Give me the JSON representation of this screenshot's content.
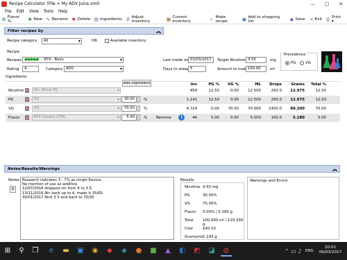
{
  "window": {
    "title": "Recipe Calculator (File = My ADV Juice.xml)",
    "minimize": "—",
    "maximize": "□",
    "close": "✕"
  },
  "menu": [
    "File",
    "Edit",
    "View",
    "Tools",
    "Help"
  ],
  "toolbar": [
    {
      "icon": "flavor-icon",
      "glyph": "❂",
      "color": "#2a8a3a",
      "label": "Flavor %"
    },
    {
      "icon": "new-icon",
      "glyph": "✚",
      "color": "#2a7a2a",
      "label": "New"
    },
    {
      "icon": "rename-icon",
      "glyph": "✎",
      "color": "#7a5a2a",
      "label": "Rename"
    },
    {
      "icon": "delete-icon",
      "glyph": "✖",
      "color": "#d02020",
      "label": "Delete"
    },
    {
      "icon": "ingredients-icon",
      "glyph": "▤",
      "color": "#3a6ab0",
      "label": "Ingredients"
    },
    {
      "icon": "adjust-icon",
      "glyph": "⇵",
      "color": "#3a6ab0",
      "label": "Adjust inventory"
    },
    {
      "icon": "inventory-icon",
      "glyph": "▦",
      "color": "#8a5a2a",
      "label": "Current inventory"
    },
    {
      "icon": "make-recipe-icon",
      "glyph": "✓",
      "color": "#2a8a2a",
      "label": "Make recipe"
    },
    {
      "icon": "shopping-list-icon",
      "glyph": "▣",
      "color": "#3a6ab0",
      "label": "Add to shopping list"
    },
    {
      "icon": "save-icon",
      "glyph": "▪",
      "color": "#2a4aa0",
      "label": "Save"
    },
    {
      "icon": "exit-icon",
      "glyph": "⇥",
      "color": "#2a8a3a",
      "label": "Exit"
    },
    {
      "icon": "print-icon",
      "glyph": "⎙",
      "color": "#555555",
      "label": "Print ▾"
    }
  ],
  "filter": {
    "header": "Filter recipes by",
    "category_label": "Recipe category",
    "category_value": "All",
    "or_label": "OR",
    "available_label": "Available inventory"
  },
  "recipe": {
    "section_label": "Recipe",
    "recipes_label": "Recipes",
    "recipe_value": "RY4 - Basic",
    "stars": "●●●●●",
    "rating_label": "Rating",
    "rating_value": "4",
    "category_label": "Category",
    "category_value": "ADV",
    "last_made_label": "Last made on",
    "last_made_value": "03/03/2017",
    "target_nicotine_label": "Target Nicotine",
    "target_nicotine_value": "4.50",
    "target_nicotine_unit": "mg",
    "days_steep_label": "Days to steep",
    "days_steep_value": "5",
    "amount_label": "Amount to make",
    "amount_value": "100.00",
    "amount_unit": "ml",
    "precedence_label": "Precedence",
    "pg_label": "PG",
    "vg_label": "VG"
  },
  "ingredients": {
    "section_label": "Ingredients",
    "add_button": "Add Ingredient",
    "headers": [
      "Inv",
      "PG %",
      "VG %",
      "ML",
      "Drops",
      "Grams",
      "Total %"
    ],
    "rows": [
      {
        "label": "Nicotine",
        "name": "Nic 36mg PG",
        "pct": "",
        "unit": "",
        "remove": "",
        "inv": "459",
        "pg": "12.50",
        "vg": "0.00",
        "ml": "12.500",
        "drops": "250.0",
        "grams": "12.975",
        "total": "12.50"
      },
      {
        "label": "PG",
        "name": "PG",
        "pct": "30.00",
        "unit": "%",
        "remove": "",
        "inv": "1,141",
        "pg": "12.50",
        "vg": "0.00",
        "ml": "12.500",
        "drops": "250.0",
        "grams": "12.975",
        "total": "12.50"
      },
      {
        "label": "VG",
        "name": "VG",
        "pct": "70.00",
        "unit": "%",
        "remove": "",
        "inv": "4,724",
        "pg": "0.00",
        "vg": "70.00",
        "ml": "70.000",
        "drops": "1400.0",
        "grams": "88.200",
        "total": "70.00"
      },
      {
        "label": "Flavor",
        "name": "RY4 Double (TFA)",
        "pct": "5.00",
        "unit": "%",
        "remove": "Remove",
        "inv": "46",
        "pg": "5.00",
        "vg": "0.00",
        "ml": "5.000",
        "drops": "100.0",
        "grams": "5.180",
        "total": "5.00"
      }
    ]
  },
  "notes": {
    "header": "Notes/Results/Warnings",
    "notes_label": "Notes",
    "d_button": "D",
    "lines": [
      "Research indicates 3 - 7% as single flavour.",
      "No mention of use as additive",
      "12/07/2016 dropped nic from 4 to 3.5.",
      "13/11/2016 Nic back up to 4, made it 35/65.",
      "30/01/2017 Nick 3.5 and back to 70/30"
    ],
    "results_label": "Results",
    "results": [
      {
        "label": "Nicotine",
        "value": "4.50 mg"
      },
      {
        "label": "PG",
        "value": "30.00%"
      },
      {
        "label": "VG",
        "value": "70.00%"
      },
      {
        "label": "Flavor",
        "value": "5.00% / 5.180 g"
      },
      {
        "label": "Total",
        "value": "100.000 ml / 119.330 g"
      },
      {
        "label": "Cost",
        "value": "£40.10"
      },
      {
        "label": "Grams/ml",
        "value": "1.193 g"
      }
    ],
    "warnings_label": "Warnings and Errors"
  },
  "taskbar": {
    "start": "⊞",
    "search": "⚲",
    "taskview": "❐",
    "apps": [
      {
        "name": "edge-icon",
        "glyph": "e",
        "color": "#3b8fe0"
      },
      {
        "name": "explorer-icon",
        "glyph": "▬",
        "color": "#e8c250"
      },
      {
        "name": "store-icon",
        "glyph": "▣",
        "color": "#3b8fe0"
      },
      {
        "name": "chrome-icon",
        "glyph": "◉",
        "color": "#e0b030"
      },
      {
        "name": "app-icon-1",
        "glyph": "◆",
        "color": "#d04040"
      },
      {
        "name": "app-icon-2",
        "glyph": "◈",
        "color": "#40a0d0"
      },
      {
        "name": "app-icon-3",
        "glyph": "●",
        "color": "#e07030"
      },
      {
        "name": "app-icon-4",
        "glyph": "■",
        "color": "#60b040"
      },
      {
        "name": "app-icon-5",
        "glyph": "▲",
        "color": "#9060d0"
      },
      {
        "name": "app-icon-6",
        "glyph": "◧",
        "color": "#3070c0"
      },
      {
        "name": "app-icon-7",
        "glyph": "◩",
        "color": "#d03030"
      },
      {
        "name": "app-icon-8",
        "glyph": "◪",
        "color": "#30a0a0"
      },
      {
        "name": "recipe-app-icon",
        "glyph": "◍",
        "color": "#c04040"
      }
    ],
    "lang": "ENG",
    "time": "20:51",
    "date": "06/03/2017"
  }
}
